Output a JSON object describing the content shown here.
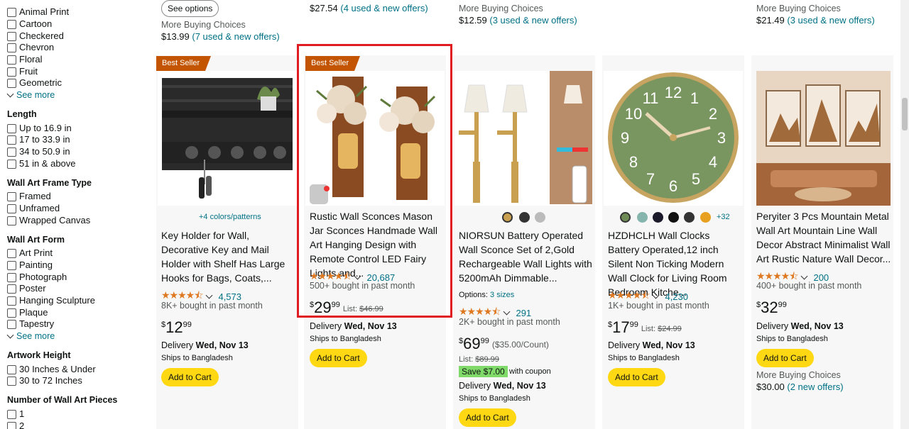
{
  "sidebar": {
    "pattern_items": [
      "Animal Print",
      "Cartoon",
      "Checkered",
      "Chevron",
      "Floral",
      "Fruit",
      "Geometric"
    ],
    "see_more_1": "See more",
    "length_head": "Length",
    "length_items": [
      "Up to 16.9 in",
      "17 to 33.9 in",
      "34 to 50.9 in",
      "51 in & above"
    ],
    "frame_head": "Wall Art Frame Type",
    "frame_items": [
      "Framed",
      "Unframed",
      "Wrapped Canvas"
    ],
    "form_head": "Wall Art Form",
    "form_items": [
      "Art Print",
      "Painting",
      "Photograph",
      "Poster",
      "Hanging Sculpture",
      "Plaque",
      "Tapestry"
    ],
    "see_more_2": "See more",
    "height_head": "Artwork Height",
    "height_items": [
      "30 Inches & Under",
      "30 to 72 Inches"
    ],
    "pieces_head": "Number of Wall Art Pieces",
    "pieces_items": [
      "1",
      "2"
    ]
  },
  "top_row": {
    "see_options": "See options",
    "c1_mbc": "More Buying Choices",
    "c1_price": "$13.99",
    "c1_offers": "(7 used & new offers)",
    "c2_price": "$27.54",
    "c2_offers": "(4 used & new offers)",
    "c3_mbc": "More Buying Choices",
    "c3_price": "$12.59",
    "c3_offers": "(3 used & new offers)",
    "c5_mbc": "More Buying Choices",
    "c5_price": "$21.49",
    "c5_offers": "(3 used & new offers)"
  },
  "products": [
    {
      "badge": "Best Seller",
      "variants": "+4 colors/patterns",
      "title": "Key Holder for Wall, Decorative Key and Mail Holder with Shelf Has Large Hooks for Bags, Coats,...",
      "rating_count": "4,573",
      "bought": "8K+ bought in past month",
      "price_whole": "12",
      "price_frac": "99",
      "delivery_label": "Delivery",
      "delivery_date": "Wed, Nov 13",
      "ships": "Ships to Bangladesh",
      "cart": "Add to Cart"
    },
    {
      "badge": "Best Seller",
      "title": "Rustic Wall Sconces Mason Jar Sconces Handmade Wall Art Hanging Design with Remote Control LED Fairy Lights and...",
      "rating_count": "20,687",
      "bought": "500+ bought in past month",
      "price_whole": "29",
      "price_frac": "99",
      "list_label": "List:",
      "list_price": "$46.99",
      "delivery_label": "Delivery",
      "delivery_date": "Wed, Nov 13",
      "ships": "Ships to Bangladesh",
      "cart": "Add to Cart"
    },
    {
      "title": "NIORSUN Battery Operated Wall Sconce Set of 2,Gold Rechargeable Wall Lights with 5200mAh Dimmable...",
      "options_label": "Options:",
      "options_value": "3 sizes",
      "rating_count": "291",
      "bought": "2K+ bought in past month",
      "price_whole": "69",
      "price_frac": "99",
      "unit_price": "($35.00/Count)",
      "list_label": "List:",
      "list_price": "$89.99",
      "save": "Save $7.00",
      "coupon": "with coupon",
      "delivery_label": "Delivery",
      "delivery_date": "Wed, Nov 13",
      "ships": "Ships to Bangladesh",
      "cart": "Add to Cart"
    },
    {
      "variants": "+32",
      "title": "HZDHCLH Wall Clocks Battery Operated,12 inch Silent Non Ticking Modern Wall Clock for Living Room Bedroom Kitche...",
      "rating_count": "4,230",
      "bought": "1K+ bought in past month",
      "price_whole": "17",
      "price_frac": "99",
      "list_label": "List:",
      "list_price": "$24.99",
      "delivery_label": "Delivery",
      "delivery_date": "Wed, Nov 13",
      "ships": "Ships to Bangladesh",
      "cart": "Add to Cart"
    },
    {
      "title": "Peryiter 3 Pcs Mountain Metal Wall Art Mountain Line Wall Decor Abstract Minimalist Wall Art Rustic Nature Wall Decor...",
      "rating_count": "200",
      "bought": "400+ bought in past month",
      "price_whole": "32",
      "price_frac": "99",
      "delivery_label": "Delivery",
      "delivery_date": "Wed, Nov 13",
      "ships": "Ships to Bangladesh",
      "cart": "Add to Cart",
      "mbc": "More Buying Choices",
      "mbc_price": "$30.00",
      "mbc_offers": "(2 new offers)"
    }
  ],
  "clock_numbers": [
    "12",
    "1",
    "2",
    "3",
    "4",
    "5",
    "6",
    "7",
    "8",
    "9",
    "10",
    "11"
  ],
  "colors": {
    "accent_red": "#e11b22",
    "badge": "#c45500",
    "link": "#007185",
    "star": "#de7921",
    "button": "#ffd814"
  }
}
